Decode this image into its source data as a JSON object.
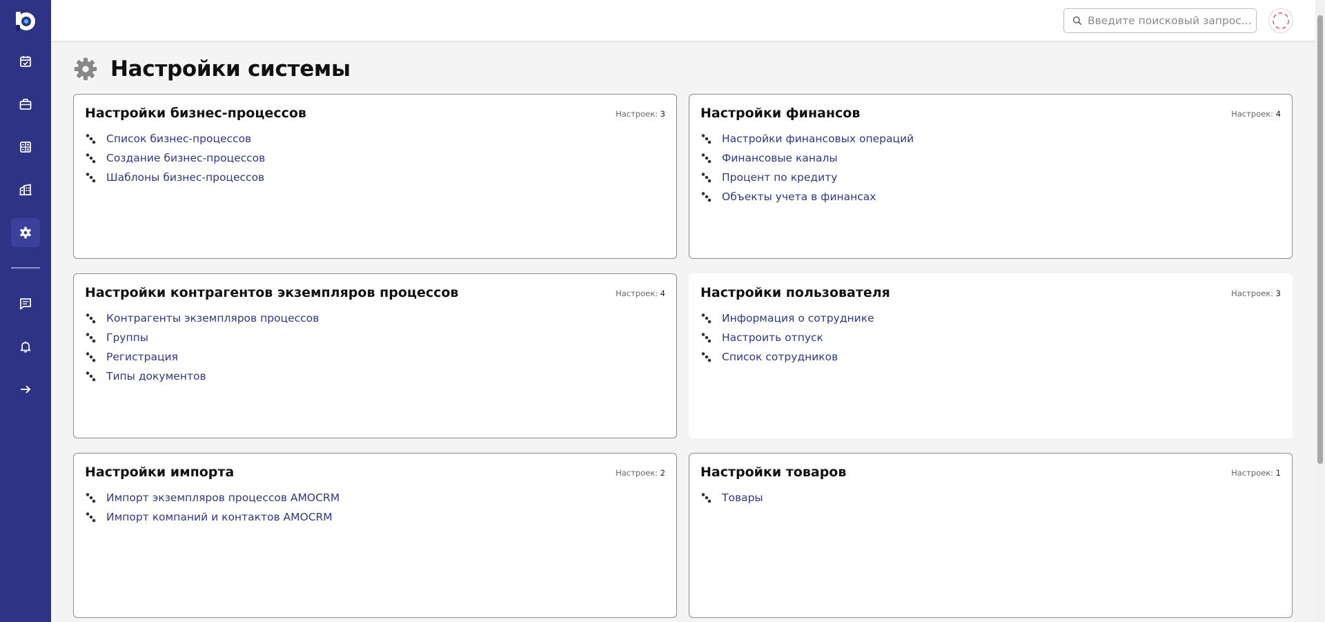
{
  "header": {
    "search_placeholder": "Введите поисковый запрос..."
  },
  "sidebar": {
    "items": [
      {
        "icon": "calendar-check-icon"
      },
      {
        "icon": "briefcase-icon"
      },
      {
        "icon": "calculator-icon"
      },
      {
        "icon": "buildings-icon"
      },
      {
        "icon": "gear-icon",
        "active": true
      },
      {
        "icon": "chat-icon"
      },
      {
        "icon": "bell-icon"
      },
      {
        "icon": "arrow-right-icon"
      }
    ]
  },
  "page": {
    "title": "Настройки системы",
    "count_label": "Настроек:"
  },
  "cards": [
    {
      "title": "Настройки бизнес-процессов",
      "count": "3",
      "items": [
        "Список бизнес-процессов",
        "Создание бизнес-процессов",
        "Шаблоны бизнес-процессов"
      ]
    },
    {
      "title": "Настройки финансов",
      "count": "4",
      "items": [
        "Настройки финансовых операций",
        "Финансовые каналы",
        "Процент по кредиту",
        "Объекты учета в финансах"
      ]
    },
    {
      "title": "Настройки контрагентов экземпляров процессов",
      "count": "4",
      "items": [
        "Контрагенты экземпляров процессов",
        "Группы",
        "Регистрация",
        "Типы документов"
      ]
    },
    {
      "title": "Настройки пользователя",
      "count": "3",
      "items": [
        "Информация о сотруднике",
        "Настроить отпуск",
        "Список сотрудников"
      ]
    },
    {
      "title": "Настройки импорта",
      "count": "2",
      "items": [
        "Импорт экземпляров процессов AMOCRM",
        "Импорт компаний и контактов AMOCRM"
      ]
    },
    {
      "title": "Настройки товаров",
      "count": "1",
      "items": [
        "Товары"
      ]
    }
  ],
  "colors": {
    "sidebar": "#2e3386",
    "link": "#2e3786",
    "background": "#f4f4f5"
  }
}
